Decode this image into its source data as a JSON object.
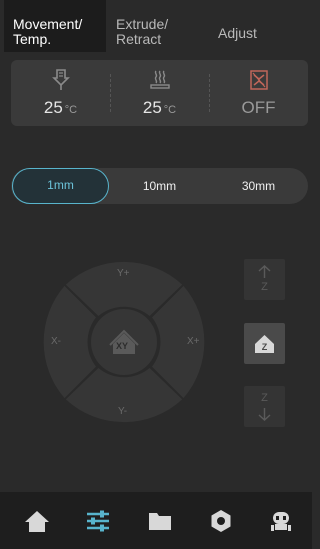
{
  "tabs": [
    {
      "line1": "Movement/",
      "line2": "Temp.",
      "active": true
    },
    {
      "line1": "Extrude/",
      "line2": "Retract",
      "active": false
    },
    {
      "line1": "Adjust",
      "line2": "",
      "active": false
    }
  ],
  "temps": {
    "nozzle": {
      "value": "25",
      "unit": "°C",
      "icon": "nozzle-icon"
    },
    "bed": {
      "value": "25",
      "unit": "°C",
      "icon": "heated-bed-icon"
    },
    "chamber": {
      "value": "OFF",
      "icon": "chamber-fan-icon"
    }
  },
  "steps": {
    "options": [
      "1mm",
      "10mm",
      "30mm"
    ],
    "selected": "1mm"
  },
  "jog": {
    "y_plus": "Y+",
    "y_minus": "Y-",
    "x_plus": "X+",
    "x_minus": "X-",
    "home_xy": "XY",
    "z_up": "Z",
    "z_down": "Z",
    "home_z": "Z"
  },
  "bottom_nav": {
    "items": [
      "home-icon",
      "controls-icon",
      "files-icon",
      "settings-icon",
      "assistant-robot-icon"
    ],
    "active": "controls-icon"
  },
  "colors": {
    "accent": "#58b4cc",
    "background": "#2a2a2a",
    "panel": "#3a3a3a"
  }
}
